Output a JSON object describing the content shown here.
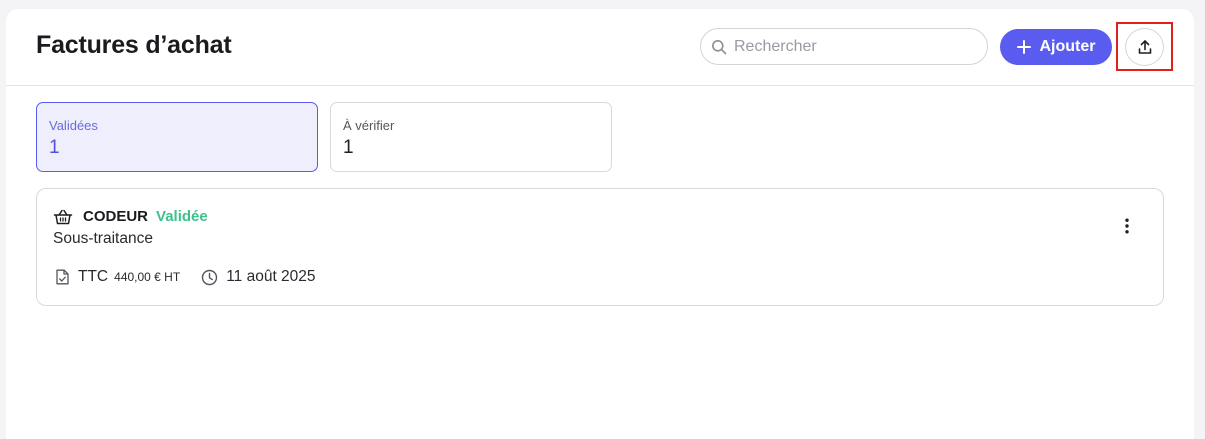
{
  "header": {
    "title": "Factures d’achat",
    "search_placeholder": "Rechercher",
    "search_value": "",
    "add_label": "Ajouter"
  },
  "filters": [
    {
      "label": "Validées",
      "count": "1",
      "active": true
    },
    {
      "label": "À vérifier",
      "count": "1",
      "active": false
    }
  ],
  "invoices": [
    {
      "vendor": "CODEUR",
      "status": "Validée",
      "category": "Sous-traitance",
      "ttc_label": "TTC",
      "ht_amount": "440,00 € HT",
      "date": "11 août 2025"
    }
  ],
  "colors": {
    "accent": "#5a5cf0",
    "status_validated": "#3cc28a",
    "highlight": "#e0211b"
  },
  "icons": {
    "search": "search-icon",
    "add": "plus-icon",
    "upload": "upload-icon",
    "vendor": "basket-icon",
    "amount": "document-check-icon",
    "date": "clock-icon",
    "more": "more-vertical-icon"
  }
}
